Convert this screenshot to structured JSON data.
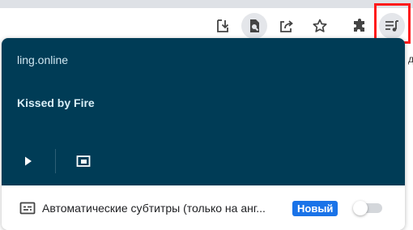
{
  "toolbar": {
    "icons": [
      "download-icon",
      "zoom-search-icon",
      "share-icon",
      "bookmark-star-icon",
      "extensions-puzzle-icon",
      "media-control-icon"
    ]
  },
  "edge_label": "д",
  "media": {
    "site": "ling.online",
    "track_title": "Kissed by Fire",
    "play_icon": "play-icon",
    "pip_icon": "picture-in-picture-icon"
  },
  "captions": {
    "label": "Автоматические субтитры (только на анг...",
    "badge": "Новый",
    "toggle_on": false
  },
  "colors": {
    "media_bg": "#003c56",
    "badge_bg": "#1a73e8",
    "highlight": "#ff1a1a"
  }
}
